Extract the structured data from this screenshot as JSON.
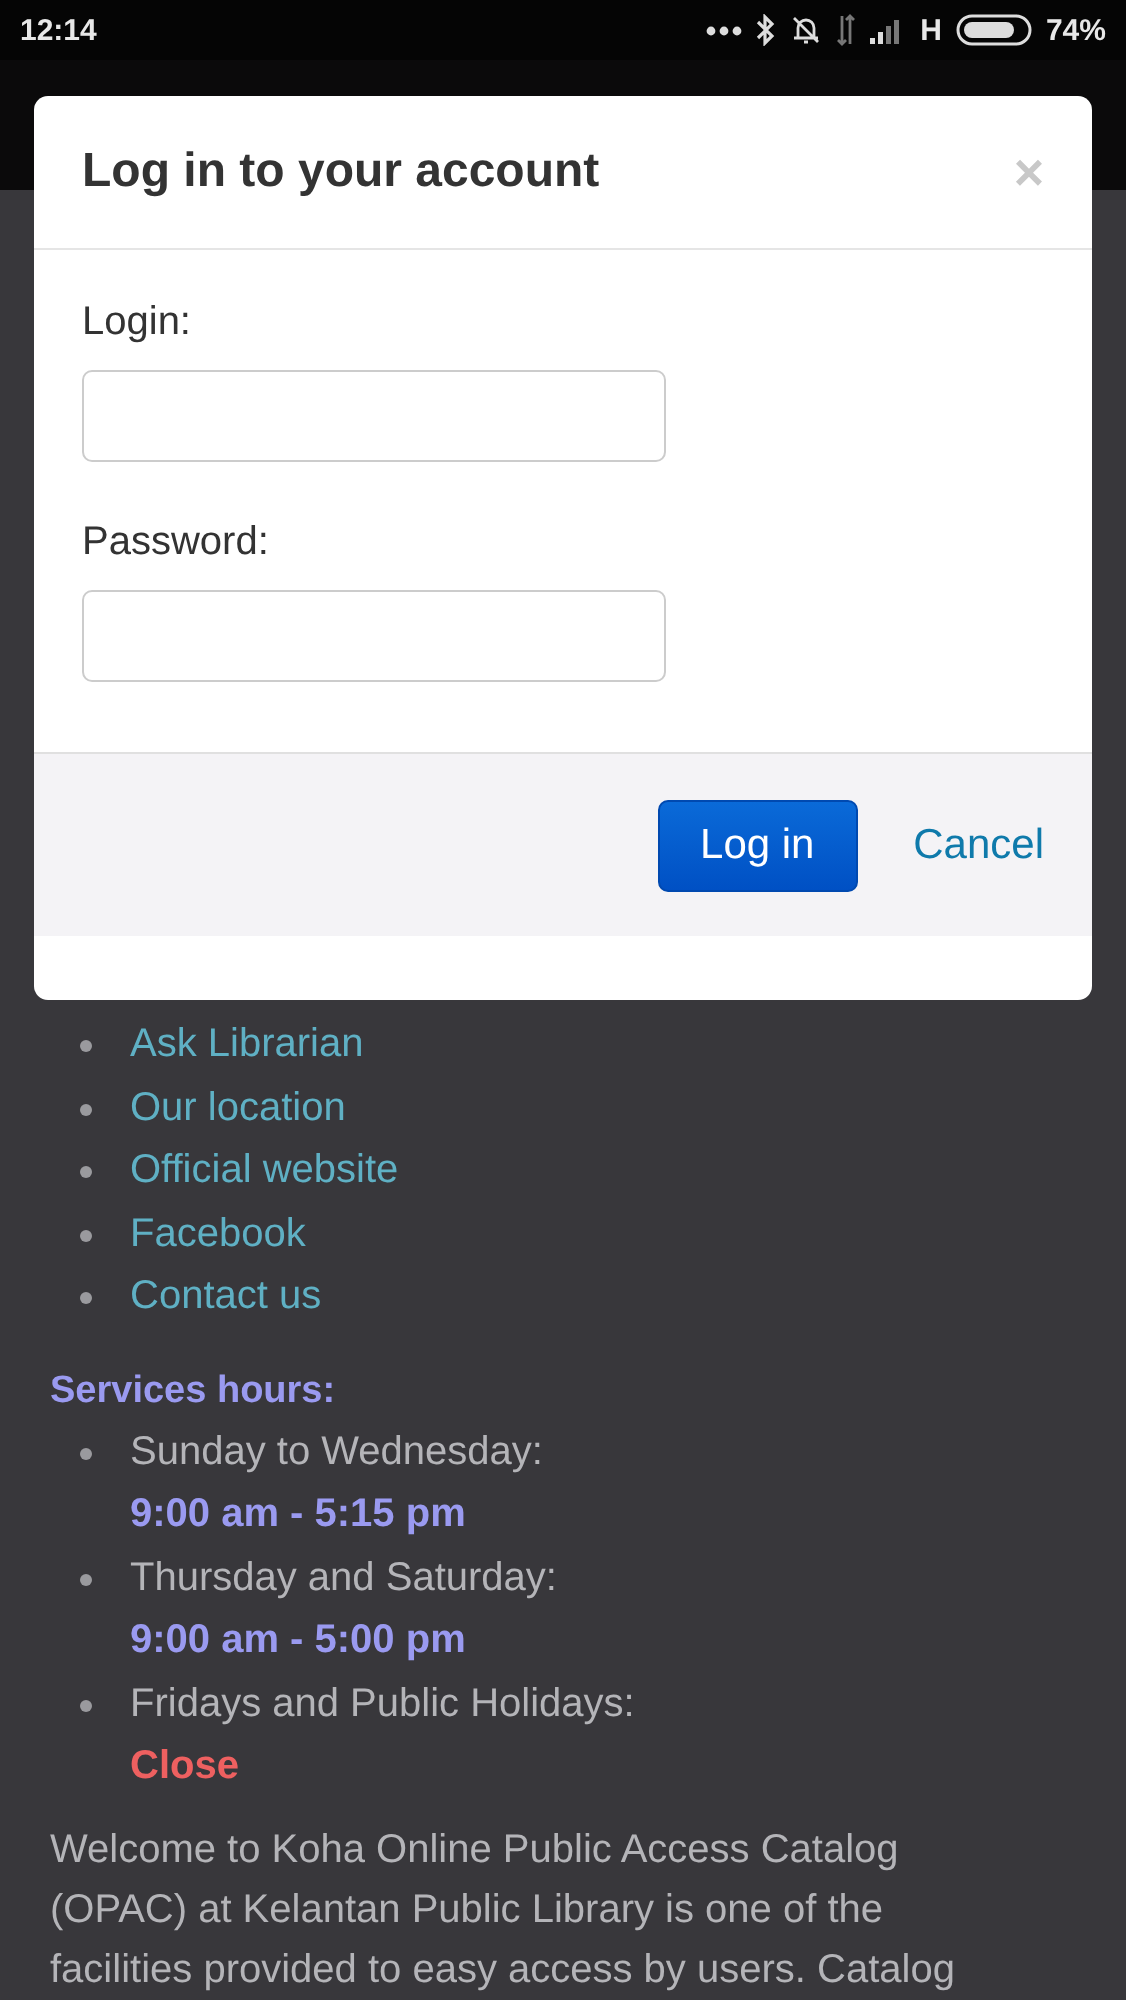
{
  "status_bar": {
    "time": "12:14",
    "network": "H",
    "battery": "74%"
  },
  "dialog": {
    "title": "Log in to your account",
    "close": "×",
    "fields": [
      {
        "label": "Login:"
      },
      {
        "label": "Password:"
      }
    ],
    "buttons": [
      {
        "label": "Log in",
        "kind": "primary"
      },
      {
        "label": "Cancel",
        "kind": "link"
      }
    ]
  },
  "page": {
    "links": [
      "Ask Librarian",
      "Our location",
      "Official website",
      "Facebook",
      "Contact us"
    ],
    "hours_title": "Services hours:",
    "hours": [
      {
        "day": "Sunday to Wednesday:",
        "time": "9:00 am - 5:15 pm",
        "kind": "open"
      },
      {
        "day": "Thursday and Saturday:",
        "time": "9:00 am - 5:00 pm",
        "kind": "open"
      },
      {
        "day": "Fridays and Public Holidays:",
        "time": "Close",
        "kind": "closed"
      }
    ],
    "welcome": "Welcome to Koha Online Public Access Catalog (OPAC) at Kelantan Public Library is one of the facilities provided to easy access by users. Catalog"
  }
}
